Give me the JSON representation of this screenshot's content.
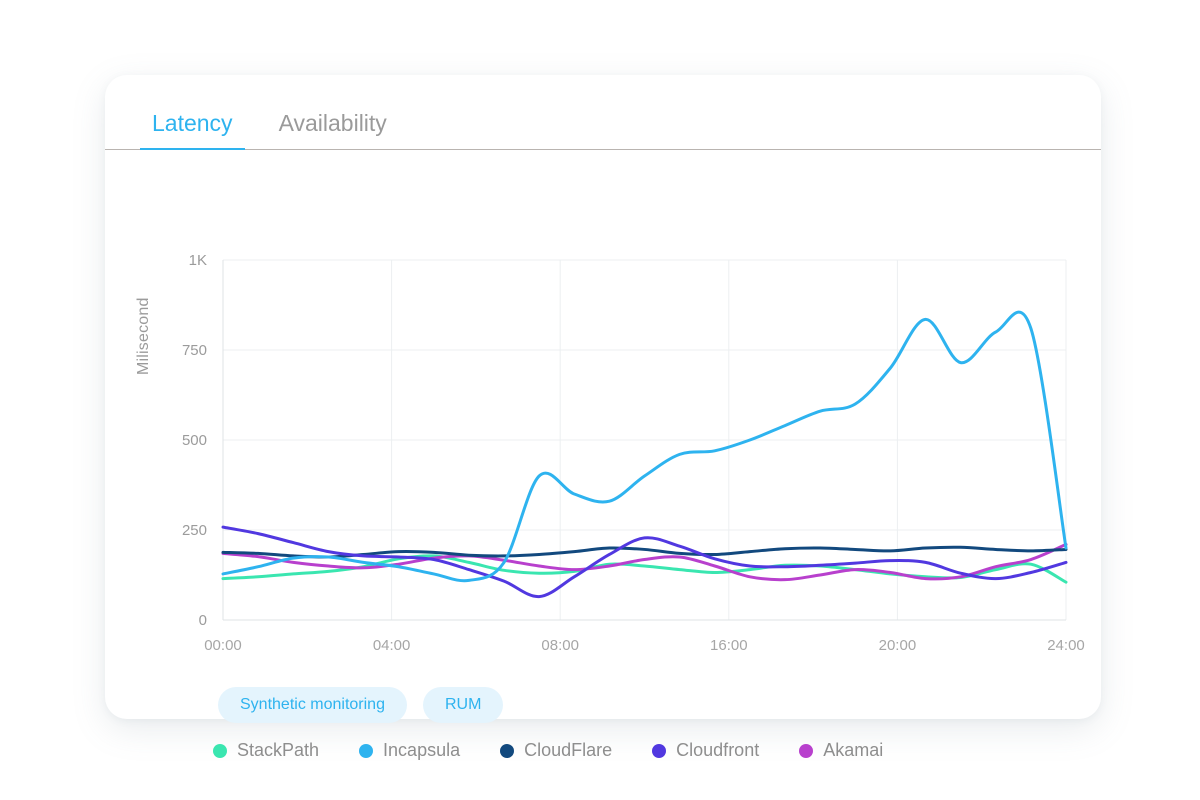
{
  "card": {
    "tabs": [
      {
        "label": "Latency",
        "active": true
      },
      {
        "label": "Availability",
        "active": false
      }
    ]
  },
  "filters": {
    "pills": [
      {
        "label": "Synthetic monitoring"
      },
      {
        "label": "RUM"
      }
    ]
  },
  "colors": {
    "accent": "#2eb3ef",
    "tab_inactive": "#9a9a9a",
    "pill_bg": "#e4f4fd",
    "grid": "#eceff1",
    "tick_text": "#9b9b9b"
  },
  "chart_data": {
    "type": "line",
    "title": "",
    "xlabel": "",
    "ylabel": "Milisecond",
    "ylim": [
      0,
      1000
    ],
    "yticks": [
      0,
      250,
      500,
      750,
      1000
    ],
    "ytick_labels": [
      "0",
      "250",
      "500",
      "750",
      "1K"
    ],
    "grid": true,
    "legend_position": "bottom",
    "x": [
      0,
      1,
      2,
      3,
      4,
      5,
      6,
      7,
      8,
      9,
      10,
      11,
      12,
      13,
      14,
      15,
      16,
      17,
      18,
      19,
      20,
      21,
      22,
      23,
      24
    ],
    "xticks": [
      0,
      4,
      8,
      12,
      16,
      20,
      24
    ],
    "xtick_labels": [
      "00:00",
      "04:00",
      "08:00",
      "16:00",
      "20:00",
      "24:00"
    ],
    "xtick_values": [
      0,
      4,
      8,
      16,
      20,
      24
    ],
    "series": [
      {
        "name": "StackPath",
        "color": "#3ae6b0",
        "values": [
          115,
          120,
          128,
          135,
          148,
          170,
          178,
          160,
          138,
          130,
          135,
          155,
          150,
          140,
          132,
          140,
          152,
          150,
          140,
          128,
          120,
          118,
          140,
          155,
          105
        ]
      },
      {
        "name": "Incapsula",
        "color": "#2eb3ef",
        "values": [
          128,
          148,
          172,
          175,
          160,
          148,
          128,
          110,
          160,
          400,
          350,
          330,
          400,
          460,
          470,
          500,
          540,
          580,
          600,
          700,
          835,
          715,
          800,
          810,
          200
        ]
      },
      {
        "name": "CloudFlare",
        "color": "#12497e",
        "values": [
          188,
          185,
          178,
          175,
          182,
          190,
          188,
          180,
          178,
          182,
          190,
          200,
          196,
          185,
          182,
          190,
          198,
          200,
          196,
          192,
          200,
          202,
          196,
          192,
          196
        ]
      },
      {
        "name": "Cloudfront",
        "color": "#5138e0",
        "values": [
          258,
          240,
          215,
          190,
          178,
          175,
          168,
          140,
          108,
          65,
          120,
          182,
          228,
          205,
          170,
          150,
          148,
          152,
          158,
          165,
          160,
          130,
          115,
          132,
          160
        ]
      },
      {
        "name": "Akamai",
        "color": "#b840cd",
        "values": [
          185,
          176,
          160,
          150,
          145,
          155,
          172,
          178,
          166,
          150,
          140,
          150,
          168,
          175,
          150,
          120,
          112,
          125,
          140,
          132,
          115,
          120,
          148,
          168,
          210
        ]
      }
    ]
  },
  "legend": {
    "items": [
      {
        "label": "StackPath",
        "color": "#3ae6b0"
      },
      {
        "label": "Incapsula",
        "color": "#2eb3ef"
      },
      {
        "label": "CloudFlare",
        "color": "#12497e"
      },
      {
        "label": "Cloudfront",
        "color": "#5138e0"
      },
      {
        "label": "Akamai",
        "color": "#b840cd"
      }
    ]
  }
}
